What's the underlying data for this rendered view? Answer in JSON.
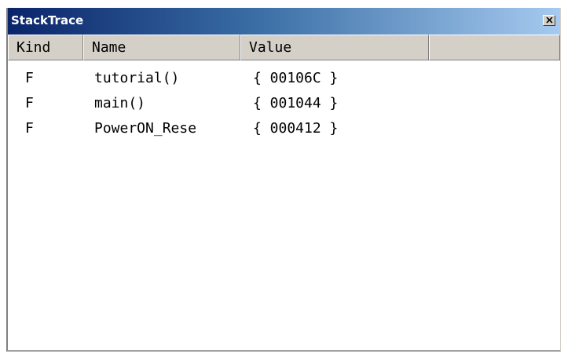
{
  "window": {
    "title": "StackTrace",
    "close_icon": "close-icon"
  },
  "columns": [
    "Kind",
    "Name",
    "Value",
    ""
  ],
  "rows": [
    {
      "kind": "F",
      "name": "tutorial()",
      "value": "{ 00106C }"
    },
    {
      "kind": "F",
      "name": "main()",
      "value": "{ 001044 }"
    },
    {
      "kind": "F",
      "name": "PowerON_Rese",
      "value": "{ 000412 }"
    }
  ],
  "colors": {
    "titlebar_start": "#0a246a",
    "titlebar_end": "#a6caf0",
    "header_bg": "#d4d0c8"
  }
}
